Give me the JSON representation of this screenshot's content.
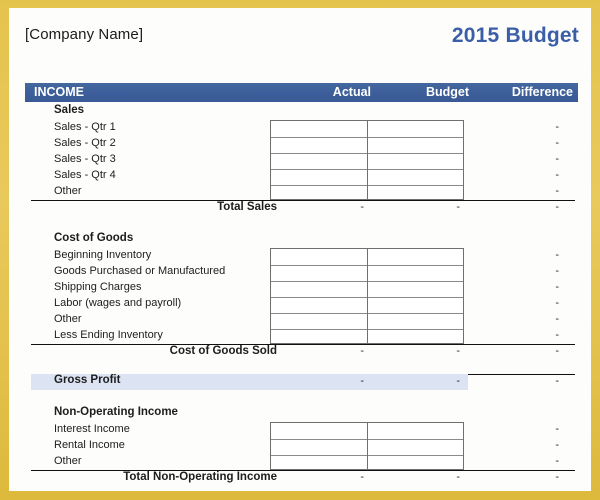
{
  "document": {
    "company_name": "[Company Name]",
    "title": "2015 Budget",
    "watermark": ""
  },
  "columns": {
    "section_label": "INCOME",
    "actual": "Actual",
    "budget": "Budget",
    "difference": "Difference"
  },
  "empty_value": "-",
  "sections": [
    {
      "heading": "Sales",
      "rows": [
        {
          "label": "Sales - Qtr 1",
          "actual": "",
          "budget": "",
          "difference": "-"
        },
        {
          "label": "Sales - Qtr 2",
          "actual": "",
          "budget": "",
          "difference": "-"
        },
        {
          "label": "Sales - Qtr 3",
          "actual": "",
          "budget": "",
          "difference": "-"
        },
        {
          "label": "Sales - Qtr 4",
          "actual": "",
          "budget": "",
          "difference": "-"
        },
        {
          "label": "Other",
          "actual": "",
          "budget": "",
          "difference": "-"
        }
      ],
      "total": {
        "label": "Total Sales",
        "actual": "-",
        "budget": "-",
        "difference": "-"
      }
    },
    {
      "heading": "Cost of Goods",
      "rows": [
        {
          "label": "Beginning Inventory",
          "actual": "",
          "budget": "",
          "difference": "-"
        },
        {
          "label": "Goods Purchased or Manufactured",
          "actual": "",
          "budget": "",
          "difference": "-"
        },
        {
          "label": "Shipping Charges",
          "actual": "",
          "budget": "",
          "difference": "-"
        },
        {
          "label": "Labor (wages and payroll)",
          "actual": "",
          "budget": "",
          "difference": "-"
        },
        {
          "label": "Other",
          "actual": "",
          "budget": "",
          "difference": "-"
        },
        {
          "label": "Less Ending Inventory",
          "actual": "",
          "budget": "",
          "difference": "-"
        }
      ],
      "total": {
        "label": "Cost of Goods Sold",
        "actual": "-",
        "budget": "-",
        "difference": "-"
      }
    },
    {
      "heading": "Non-Operating Income",
      "rows": [
        {
          "label": "Interest Income",
          "actual": "",
          "budget": "",
          "difference": "-"
        },
        {
          "label": "Rental Income",
          "actual": "",
          "budget": "",
          "difference": "-"
        },
        {
          "label": "Other",
          "actual": "",
          "budget": "",
          "difference": "-"
        }
      ],
      "total": {
        "label": "Total Non-Operating Income",
        "actual": "-",
        "budget": "-",
        "difference": "-"
      }
    }
  ],
  "gross_profit": {
    "label": "Gross Profit",
    "actual": "-",
    "budget": "-",
    "difference": "-"
  },
  "colors": {
    "frame": "#e4c34d",
    "header_bar": "#3d5e9a",
    "title_blue": "#3a5fa8",
    "highlight_band": "#dce3f2",
    "sheet_bg": "#fdfdfb"
  }
}
